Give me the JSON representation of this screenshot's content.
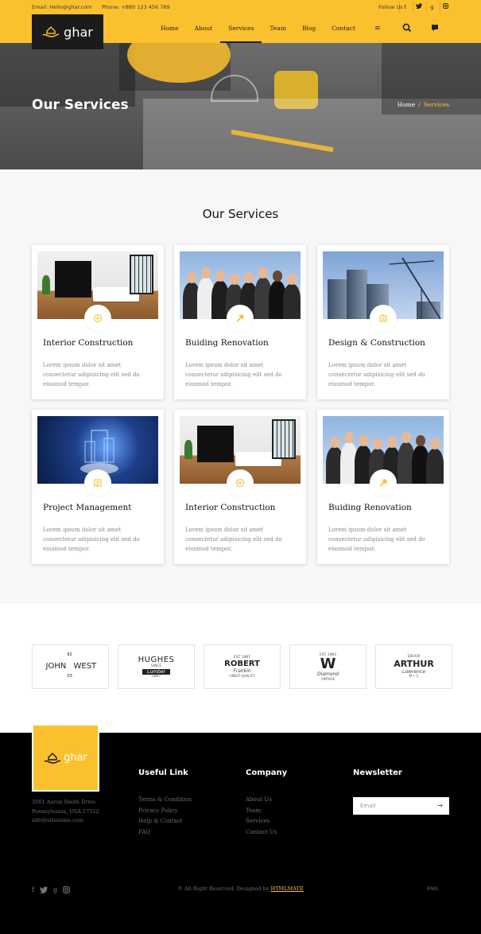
{
  "topbar": {
    "email": "Email: Hello@ghar.com",
    "phone": "Phone: +880 123 456 789",
    "follow_label": "Follow Us :",
    "social": [
      "f",
      "t",
      "g",
      "i"
    ]
  },
  "brand": {
    "name": "ghar"
  },
  "nav": {
    "items": [
      "Home",
      "About",
      "Services",
      "Team",
      "Blog",
      "Contact"
    ],
    "active": "Services",
    "menu_glyph": "≡",
    "icons": [
      "search-icon",
      "chat-icon"
    ]
  },
  "hero": {
    "title": "Our Services",
    "breadcrumb": {
      "home": "Home",
      "sep": "/",
      "current": "Services"
    }
  },
  "services": {
    "heading": "Our Services",
    "cards": [
      {
        "title": "Interior Construction",
        "desc": "Lorem ipsum dolor sit amet consectetur adipisicing elit sed do eiusmod tempor.",
        "icon": "interior-icon",
        "scene": "interior"
      },
      {
        "title": "Buiding Renovation",
        "desc": "Lorem ipsum dolor sit amet consectetur adipisicing elit sed do eiusmod tempor.",
        "icon": "tools-icon",
        "scene": "team"
      },
      {
        "title": "Design & Construction",
        "desc": "Lorem ipsum dolor sit amet consectetur adipisicing elit sed do eiusmod tempor.",
        "icon": "building-icon",
        "scene": "crane"
      },
      {
        "title": "Project Management",
        "desc": "Lorem ipsum dolor sit amet consectetur adipisicing elit sed do eiusmod tempor.",
        "icon": "list-icon",
        "scene": "tech"
      },
      {
        "title": "Interior Construction",
        "desc": "Lorem ipsum dolor sit amet consectetur adipisicing elit sed do eiusmod tempor.",
        "icon": "interior-icon",
        "scene": "interior"
      },
      {
        "title": "Buiding Renovation",
        "desc": "Lorem ipsum dolor sit amet consectetur adipisicing elit sed do eiusmod tempor.",
        "icon": "tools-icon",
        "scene": "team"
      }
    ]
  },
  "partners": [
    {
      "line1": "JOHN",
      "line2": "WEST",
      "tag1": "82",
      "tag2": "03"
    },
    {
      "line1": "HUGHES",
      "line2": "Lumber",
      "tag1": "SINCE",
      "tag2": "1887"
    },
    {
      "line1": "ROBERT",
      "line2": "Frankin",
      "tag1": "EST 1987",
      "tag2": "FINEST QUALITY"
    },
    {
      "line1": "W",
      "line2": "Diamond",
      "tag1": "EST 1982",
      "tag2": "VINTAGE"
    },
    {
      "line1": "ARTHUR",
      "line2": "Lawrence",
      "tag1": "EBOOK",
      "tag2": "N • 1"
    }
  ],
  "footer": {
    "address": [
      "3561 Aaron Smith Drive",
      "Pennsylvania, USA 17512",
      "info@sitename.com"
    ],
    "useful_links": {
      "title": "Useful Link",
      "items": [
        "Terms & Condition",
        "Privacy Policy",
        "Help & Contact",
        "FAQ"
      ]
    },
    "company": {
      "title": "Company",
      "items": [
        "About Us",
        "Team",
        "Services",
        "Contact Us"
      ]
    },
    "newsletter": {
      "title": "Newsletter",
      "placeholder": "Email",
      "arrow": "→"
    },
    "social": [
      "f",
      "t",
      "g",
      "i"
    ],
    "copyright": "© All Right Reserved. Designed by",
    "designer": "HTMLMATE",
    "lang": "ENG"
  },
  "colors": {
    "accent": "#fbc02d",
    "dark": "#1b1b1b",
    "footer_bg": "#000000"
  }
}
